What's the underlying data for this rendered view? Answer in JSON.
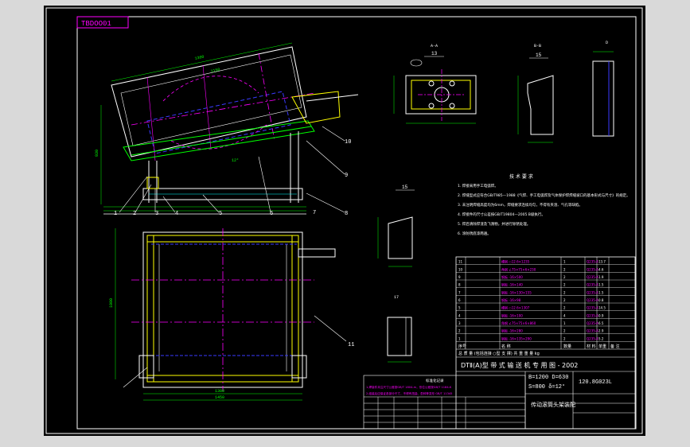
{
  "drawing": {
    "corner_code": "TBDOO01",
    "view_names": {
      "a_a": "A-A",
      "section_13": "13",
      "b_b": "B-B",
      "section_15_top": "15",
      "detail_d": "D",
      "section_15_left": "15",
      "section_17": "17"
    },
    "balloons": [
      "1",
      "2",
      "3",
      "4",
      "5",
      "6",
      "7",
      "8",
      "9",
      "10",
      "11"
    ],
    "dimensions": {
      "len_main": "1300",
      "len_inner": "1150",
      "height_left": "930",
      "angle": "12°",
      "width_bottom": "1450",
      "width_plan": "1300",
      "depth_plan": "1000"
    },
    "notes": {
      "title": "技 术 要 求",
      "items": [
        "1. 焊接采用手工电弧焊。",
        "2. 焊缝型式应符合GB/T985—1988《气焊、手工电弧焊及气体保护焊焊缝坡口的基本形式与尺寸》的规定。",
        "3. 未注明焊缝高度均为6mm，焊缝要求连续均匀，不得有夹渣、气孔等缺陷。",
        "4. 焊接件的尺寸公差按GB/T19804—2005 B级执行。",
        "5. 焊后清除焊渣及飞溅物，并进行除锈处理。",
        "6. 涂防锈底漆两遍。"
      ]
    },
    "parts_table": {
      "rows": [
        {
          "no": "11",
          "spec": "槽钢 ○12.6×1235",
          "qty": "1",
          "mat": "Q235-A",
          "weight": "13.7",
          "note": ""
        },
        {
          "no": "10",
          "spec": "角钢 ∠75×75×6×230",
          "qty": "2",
          "mat": "Q235-A",
          "weight": "4.6",
          "note": ""
        },
        {
          "no": "9",
          "spec": "钢板 -16×500",
          "qty": "2",
          "mat": "Q235-A",
          "weight": "1.9",
          "note": ""
        },
        {
          "no": "8",
          "spec": "钢板 -16×140",
          "qty": "2",
          "mat": "Q235-A",
          "weight": "1.5",
          "note": ""
        },
        {
          "no": "7",
          "spec": "钢板 -16×130×155",
          "qty": "2",
          "mat": "Q235-A",
          "weight": "1.5",
          "note": ""
        },
        {
          "no": "6",
          "spec": "钢板 -16×98",
          "qty": "2",
          "mat": "Q235-A",
          "weight": "0.8",
          "note": ""
        },
        {
          "no": "5",
          "spec": "槽钢 ○12.6×1307",
          "qty": "2",
          "mat": "Q235-A",
          "weight": "14.5",
          "note": ""
        },
        {
          "no": "4",
          "spec": "钢板 -16×100",
          "qty": "4",
          "mat": "Q235-A",
          "weight": "0.9",
          "note": ""
        },
        {
          "no": "3",
          "spec": "角钢 ∠75×75×6×860",
          "qty": "1",
          "mat": "Q235-A",
          "weight": "6.5",
          "note": ""
        },
        {
          "no": "2",
          "spec": "钢板 -16×280",
          "qty": "2",
          "mat": "Q235-A",
          "weight": "2.9",
          "note": ""
        },
        {
          "no": "1",
          "spec": "钢板 -16×135×290",
          "qty": "2",
          "mat": "Q235-A",
          "weight": "5.2",
          "note": ""
        }
      ],
      "header": {
        "no": "序号",
        "spec": "名 称",
        "qty": "数量",
        "mat": "材 料",
        "weight": "单重",
        "note": "备 注"
      },
      "footer": "总 质 量  (包括连接 ○型 支 撑)  共 重 重 量 kg",
      "series": "DTⅡ(A)型 带 式 输 送 机 专 用 图 - 2002",
      "param1": "B=1200 D=630",
      "param2": "S=800 δ=12°",
      "drawing_no": "120.8G023L",
      "name": "传动滚筒头架装配",
      "info_title": "标准化记录",
      "info_rows": [
        "1.焊接件未注尺寸公差按GB/T 1804-m，形位公差按GB/T 1184-K",
        "2.组装后应保证各部分尺寸，不得有扭曲、歪斜等变形 GB/T 11345"
      ]
    }
  }
}
